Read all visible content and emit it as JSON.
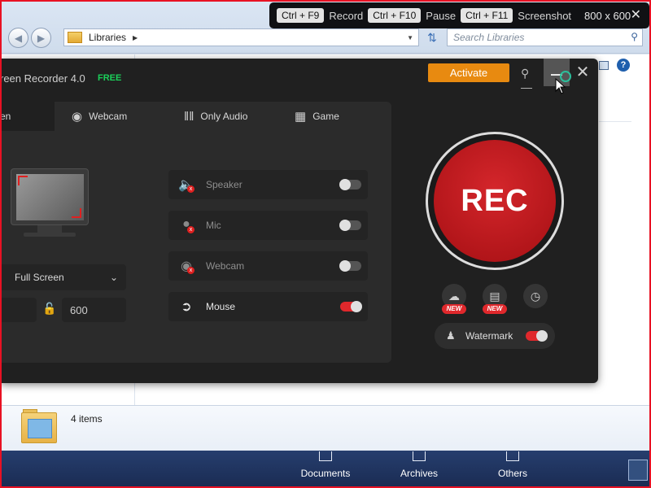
{
  "explorer": {
    "address": {
      "location": "Libraries"
    },
    "search": {
      "placeholder": "Search Libraries"
    },
    "details": {
      "items_count": "4 items"
    },
    "taskbar": {
      "items": [
        {
          "label": "Documents"
        },
        {
          "label": "Archives"
        },
        {
          "label": "Others"
        }
      ]
    }
  },
  "hotkeys": {
    "record": {
      "key": "Ctrl + F9",
      "label": "Record"
    },
    "pause": {
      "key": "Ctrl + F10",
      "label": "Pause"
    },
    "screenshot": {
      "key": "Ctrl + F11",
      "label": "Screenshot"
    },
    "resolution": "800 x 600"
  },
  "recorder": {
    "title": "reen Recorder 4.0",
    "free_badge": "FREE",
    "activate_label": "Activate",
    "tabs": [
      {
        "label": "en",
        "icon": "screen-icon",
        "active": true
      },
      {
        "label": "Webcam",
        "icon": "webcam-icon"
      },
      {
        "label": "Only Audio",
        "icon": "audio-wave-icon"
      },
      {
        "label": "Game",
        "icon": "gamepad-icon"
      }
    ],
    "area": {
      "mode": "Full Screen",
      "height": "600"
    },
    "toggles": [
      {
        "label": "Speaker",
        "icon": "speaker-icon",
        "on": false,
        "disabled": true
      },
      {
        "label": "Mic",
        "icon": "mic-icon",
        "on": false,
        "disabled": true
      },
      {
        "label": "Webcam",
        "icon": "webcam-icon",
        "on": false,
        "disabled": true
      },
      {
        "label": "Mouse",
        "icon": "mouse-click-icon",
        "on": true,
        "disabled": false
      }
    ],
    "rec_label": "REC",
    "new_badge": "NEW",
    "watermark": {
      "label": "Watermark",
      "on": true
    },
    "colors": {
      "accent": "#e88a10",
      "rec": "#c8191e",
      "free": "#1bd05a",
      "toggle_on": "#e0282c"
    }
  }
}
